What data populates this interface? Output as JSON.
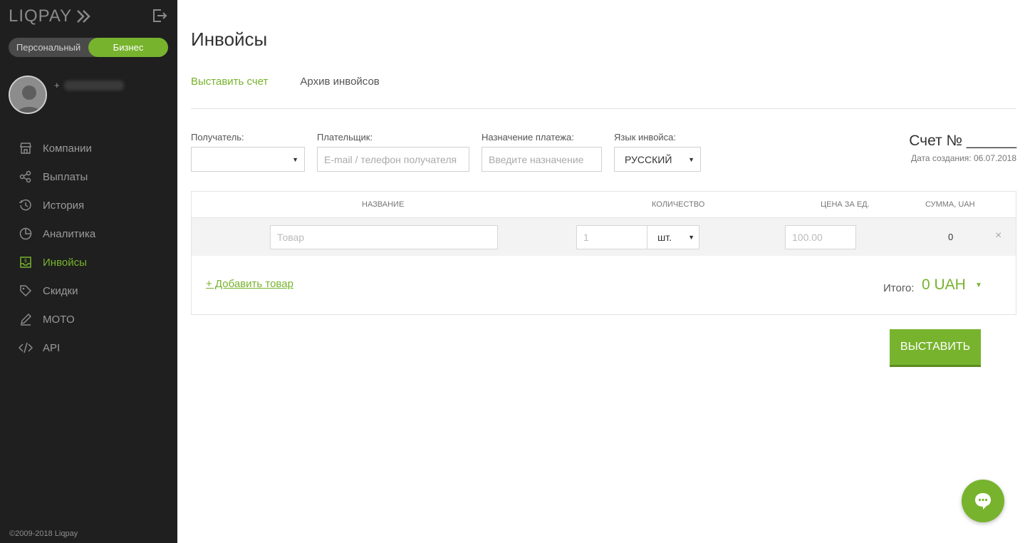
{
  "brand": {
    "name": "LIQPAY",
    "accent": "#77b32d",
    "sidebar_bg": "#1f1f1f"
  },
  "account_toggle": {
    "personal": "Персональный",
    "business": "Бизнес",
    "active": "business"
  },
  "profile": {
    "phone_prefix": "+"
  },
  "nav": [
    {
      "label": "Компании",
      "icon": "store-icon"
    },
    {
      "label": "Выплаты",
      "icon": "payouts-icon"
    },
    {
      "label": "История",
      "icon": "history-icon"
    },
    {
      "label": "Аналитика",
      "icon": "analytics-icon"
    },
    {
      "label": "Инвойсы",
      "icon": "invoice-icon",
      "active": true
    },
    {
      "label": "Скидки",
      "icon": "tag-icon"
    },
    {
      "label": "MOTO",
      "icon": "pen-icon"
    },
    {
      "label": "API",
      "icon": "code-icon"
    }
  ],
  "copyright": "©2009-2018 Liqpay",
  "page": {
    "title": "Инвойсы",
    "tabs": {
      "create": "Выставить счет",
      "archive": "Архив инвойсов"
    }
  },
  "form": {
    "recipient_label": "Получатель:",
    "payer_label": "Плательщик:",
    "payer_placeholder": "E-mail / телефон получателя",
    "purpose_label": "Назначение платежа:",
    "purpose_placeholder": "Введите назначение",
    "language_label": "Язык инвойса:",
    "language_value": "РУССКИЙ"
  },
  "invoice": {
    "number_label": "Счет № ______",
    "date_label": "Дата создания:",
    "date": "06.07.2018"
  },
  "items_table": {
    "headers": {
      "name": "НАЗВАНИЕ",
      "qty": "КОЛИЧЕСТВО",
      "price": "ЦЕНА ЗА ЕД.",
      "sum": "СУММА, UAH"
    },
    "row": {
      "name_placeholder": "Товар",
      "qty_placeholder": "1",
      "unit": "шт.",
      "price_placeholder": "100.00",
      "sum": "0",
      "remove": "×"
    },
    "add_item": "+ Добавить товар",
    "total_label": "Итого:",
    "total_value": "0 UAH"
  },
  "submit_label": "ВЫСТАВИТЬ"
}
